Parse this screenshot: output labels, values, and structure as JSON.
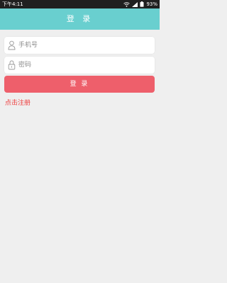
{
  "status_bar": {
    "time": "下午4:11",
    "battery": "93%",
    "icons": [
      "wifi-icon",
      "signal-icon",
      "battery-icon"
    ]
  },
  "header": {
    "title": "登 录",
    "background": "#69cfcf"
  },
  "form": {
    "phone_placeholder": "手机号",
    "phone_icon": "user-icon",
    "password_placeholder": "密码",
    "password_icon": "lock-icon"
  },
  "login_button": {
    "label": "登 录",
    "color": "#ee5f6b"
  },
  "register_link": {
    "label": "点击注册",
    "color": "#ee3b3b"
  }
}
